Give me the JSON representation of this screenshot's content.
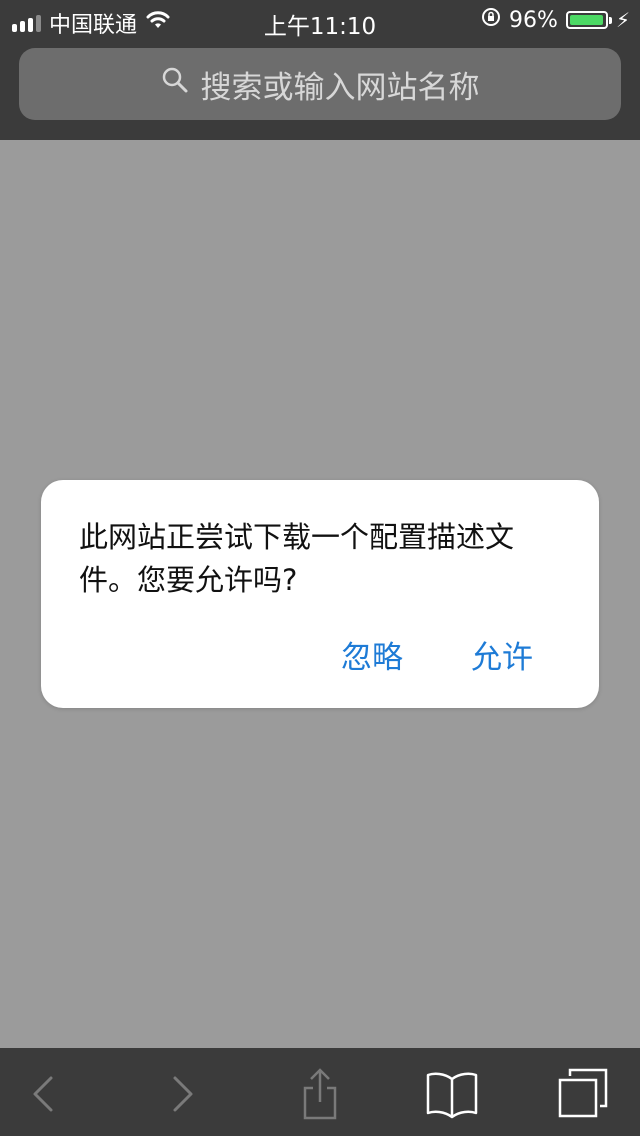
{
  "status_bar": {
    "carrier": "中国联通",
    "time": "上午11:10",
    "battery_percent": "96%",
    "battery_level": 0.96,
    "icons": [
      "signal-icon",
      "wifi-icon",
      "orientation-lock-icon",
      "battery-icon",
      "charging-icon"
    ]
  },
  "browser": {
    "url_placeholder": "搜索或输入网站名称"
  },
  "alert": {
    "message": "此网站正尝试下载一个配置描述文件。您要允许吗?",
    "ignore_label": "忽略",
    "allow_label": "允许"
  },
  "toolbar": {
    "icons": [
      "back-icon",
      "forward-icon",
      "share-icon",
      "bookmarks-icon",
      "tabs-icon"
    ]
  },
  "colors": {
    "accent": "#1e7bd6",
    "battery": "#4cd964",
    "chrome": "#3b3b3b",
    "page_overlay": "#9b9b9b"
  }
}
